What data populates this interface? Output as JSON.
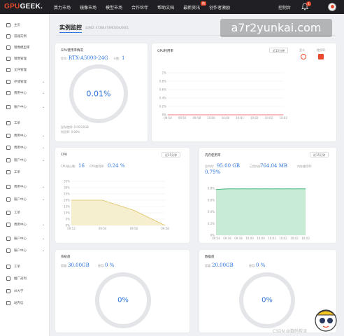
{
  "topnav": {
    "logo_a": "GPU",
    "logo_b": "GEEK.",
    "items": [
      "算力市场",
      "镜像市场",
      "模型市场",
      "合作伙伴",
      "帮助文档",
      "最新资讯",
      "创作者激励"
    ],
    "badge": "热",
    "console": "控制台",
    "notification_count": "1"
  },
  "sidebar": {
    "items": [
      {
        "label": "主页",
        "icon": "home-icon",
        "chevron": false
      },
      {
        "label": "容器实例",
        "icon": "server-icon",
        "chevron": false
      },
      {
        "label": "镜像模型库",
        "icon": "image-icon",
        "chevron": false
      },
      {
        "label": "镜像管理",
        "icon": "image-icon",
        "chevron": false
      },
      {
        "label": "文件管理",
        "icon": "folder-icon",
        "chevron": false
      },
      {
        "label": "存储管理",
        "icon": "storage-icon",
        "chevron": true
      },
      {
        "label": "费用中心",
        "icon": "money-icon",
        "chevron": true
      },
      {
        "label": "账户中心",
        "icon": "user-icon",
        "chevron": true
      },
      {
        "label": "工单",
        "icon": "ticket-icon",
        "chevron": false
      },
      {
        "label": "费用中心",
        "icon": "money-icon",
        "chevron": true
      },
      {
        "label": "费用中心",
        "icon": "money-icon",
        "chevron": true
      },
      {
        "label": "账户中心",
        "icon": "user-icon",
        "chevron": true
      },
      {
        "label": "工单",
        "icon": "ticket-icon",
        "chevron": false
      },
      {
        "label": "费用中心",
        "icon": "money-icon",
        "chevron": true
      },
      {
        "label": "账户中心",
        "icon": "user-icon",
        "chevron": true
      },
      {
        "label": "工单",
        "icon": "ticket-icon",
        "chevron": false
      },
      {
        "label": "费用中心",
        "icon": "money-icon",
        "chevron": true
      },
      {
        "label": "账户中心",
        "icon": "user-icon",
        "chevron": true
      },
      {
        "label": "账户中心",
        "icon": "user-icon",
        "chevron": true
      },
      {
        "label": "工单",
        "icon": "ticket-icon",
        "chevron": false
      },
      {
        "label": "推广返利",
        "icon": "share-icon",
        "chevron": false
      },
      {
        "label": "AI大学",
        "icon": "school-icon",
        "chevron": false
      },
      {
        "label": "站内信",
        "icon": "mail-icon",
        "chevron": false
      }
    ]
  },
  "main": {
    "title": "实例监控",
    "instance_label": "实例ID: 47364474961004/0001"
  },
  "gpu_usage": {
    "title": "GPU使用率情况",
    "model_label": "型号:",
    "model": "RTX-A5000-24G",
    "count_label": "卡数:",
    "count": "1",
    "percent": "0.01%",
    "mem_used": "显存使用: 0.00/24GB",
    "util": "利用率: 0.00%"
  },
  "gpu_chart": {
    "title": "GPU利用率",
    "range": "近15分钟",
    "legend": [
      "显卡",
      "使用率"
    ],
    "yticks": [
      "1%",
      "0.8%",
      "0.6%",
      "0.4%",
      "0.2%",
      "0%"
    ],
    "xticks": [
      "09:54",
      "09:56",
      "09:58",
      "10:00",
      "10:00",
      "10:01",
      "10:02",
      "10:02",
      "10:03"
    ]
  },
  "cpu": {
    "title": "CPU",
    "range": "近15分钟",
    "cores_label": "CPU核心数:",
    "cores": "16",
    "usage_label": "CPU使用率:",
    "usage": "0.24 %",
    "yticks": [
      "35%",
      "30%",
      "25%",
      "20%",
      "15%",
      "10%",
      "5%",
      "0%"
    ],
    "xticks": [
      "09:52",
      "09:54",
      "09:56",
      "09:58"
    ]
  },
  "memory": {
    "title": "内存使用率",
    "range": "近15分钟",
    "total_label": "总内存:",
    "total": "95.00 GB",
    "used_label": "已用内存:",
    "used": "764.04 MB",
    "pct_label": "内存使用率:",
    "pct": "0.79%",
    "yticks": [
      "0.8%",
      "0.6%",
      "0.4%",
      "0.2%",
      "0%"
    ],
    "xticks": [
      "09:54",
      "09:56",
      "09:58",
      "10:00",
      "10:00",
      "10:01",
      "10:02",
      "10:02",
      "10:03"
    ]
  },
  "system_disk": {
    "title": "系统盘",
    "cap_label": "容量:",
    "capacity": "30.00GB",
    "use_label": "使用:",
    "usage": "0 %",
    "percent": "0%"
  },
  "data_disk": {
    "title": "数据盘",
    "cap_label": "容量:",
    "capacity": "20.00GB",
    "use_label": "使用:",
    "usage": "0 %",
    "percent": "0%"
  },
  "overlay": {
    "watermark": "a7r2yunkai.com",
    "credit": "CSDN @数码帮派"
  },
  "colors": {
    "accent": "#2d74d8",
    "topbar": "#1f1f24",
    "logo": "#e84a2e",
    "cpu_line": "#e0c060",
    "mem_fill": "#c8ebd6",
    "mem_line": "#2fb56d",
    "gpu_line": "#e84a5a"
  },
  "chart_data": [
    {
      "type": "line",
      "title": "GPU利用率",
      "x": [
        "09:54",
        "09:56",
        "09:58",
        "10:00",
        "10:00",
        "10:01",
        "10:02",
        "10:02",
        "10:03"
      ],
      "series": [
        {
          "values": [
            0,
            0,
            0,
            0,
            0,
            0,
            0,
            0,
            0
          ]
        }
      ],
      "ylim": [
        0,
        1
      ],
      "grid": true
    },
    {
      "type": "area",
      "title": "CPU",
      "x": [
        "09:52",
        "09:54",
        "09:56",
        "09:58"
      ],
      "series": [
        {
          "values": [
            20,
            20,
            12,
            0
          ]
        }
      ],
      "ylim": [
        0,
        35
      ],
      "grid": true
    },
    {
      "type": "area",
      "title": "内存使用率",
      "x": [
        "09:54",
        "09:56",
        "09:58",
        "10:00",
        "10:00",
        "10:01",
        "10:02",
        "10:02",
        "10:03"
      ],
      "series": [
        {
          "values": [
            0.78,
            0.79,
            0.79,
            0.79,
            0.79,
            0.79,
            0.79,
            0.79,
            0.79
          ]
        }
      ],
      "ylim": [
        0,
        0.8
      ],
      "grid": true
    }
  ]
}
